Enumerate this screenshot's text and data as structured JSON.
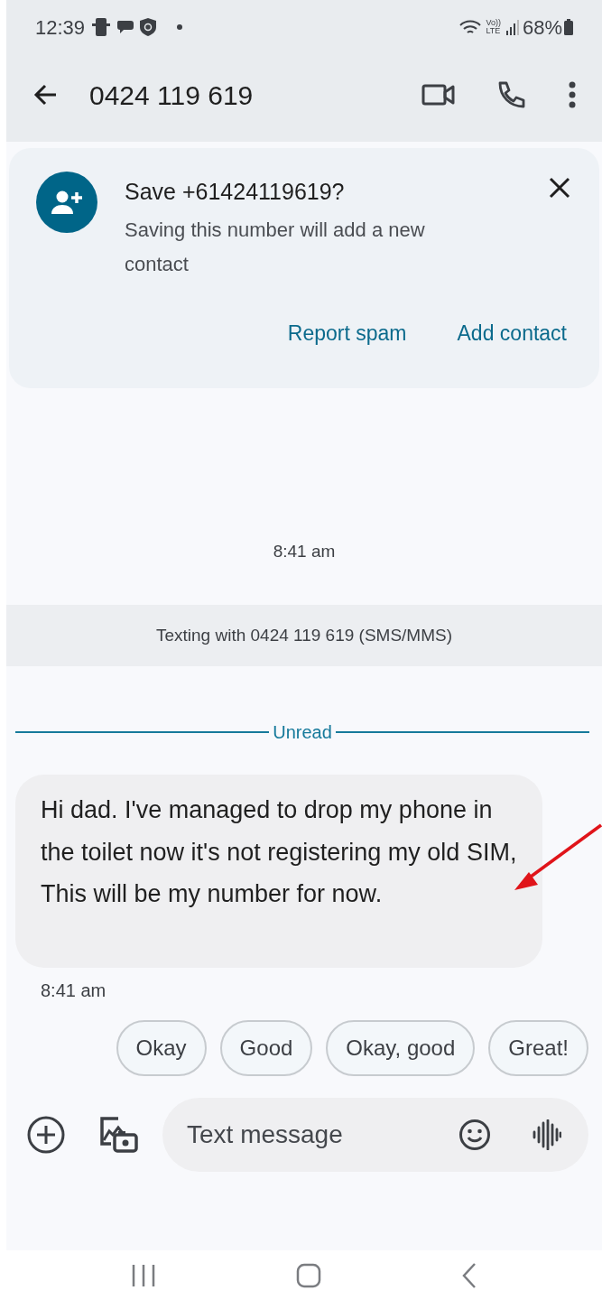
{
  "status_bar": {
    "time": "12:39",
    "network_label": [
      "Vo))",
      "LTE"
    ],
    "battery": "68%"
  },
  "header": {
    "title": "0424 119 619"
  },
  "save_card": {
    "title": "Save +61424119619?",
    "body": "Saving this number will add a new contact",
    "actions": [
      "Report spam",
      "Add contact"
    ]
  },
  "conversation_time": "8:41 am",
  "info_banner": "Texting with 0424 119 619 (SMS/MMS)",
  "divider": "Unread",
  "message": {
    "text": "Hi dad. I've managed to drop my phone in the toilet now it's not registering my old SIM, This will be my number for now.",
    "time": "8:41 am"
  },
  "suggestions": [
    "Okay",
    "Good",
    "Okay, good",
    "Great!"
  ],
  "composer": {
    "placeholder": "Text message"
  }
}
